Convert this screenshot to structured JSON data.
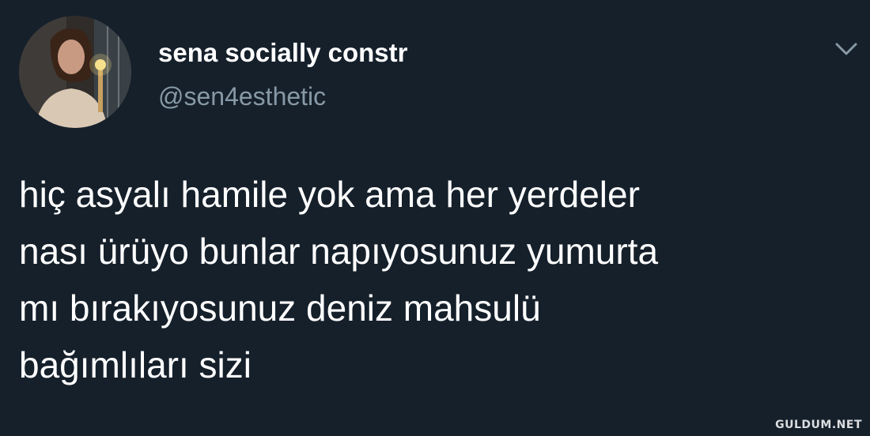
{
  "tweet": {
    "display_name": "sena socially constr",
    "handle": "@sen4esthetic",
    "text_lines": [
      "hiç asyalı hamile yok ama her yerdeler",
      "nası ürüyo bunlar napıyosunuz yumurta",
      "mı bırakıyosunuz deniz mahsulü",
      "bağımlıları sizi"
    ],
    "menu_icon": "chevron-down-icon"
  },
  "watermark": {
    "text": "GULDUM.NET"
  },
  "colors": {
    "background": "#15202b",
    "primary_text": "#ffffff",
    "secondary_text": "#8899a6"
  }
}
